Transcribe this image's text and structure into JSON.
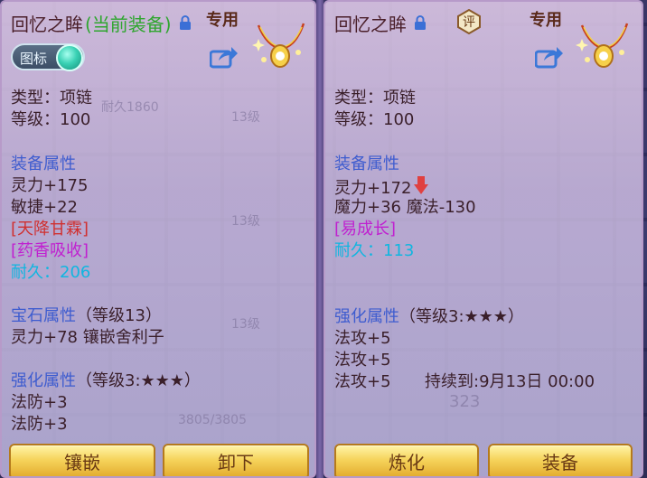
{
  "left_panel": {
    "title": "回忆之眸",
    "equipped_label": "(当前装备)",
    "special_label": "专用",
    "badge_label": "图标",
    "type_line": "类型：项链",
    "level_line": "等级：100",
    "equip_attr_head": "装备属性",
    "attrs": [
      {
        "text": "灵力+175",
        "style": "dark"
      },
      {
        "text": "敏捷+22",
        "style": "dark"
      },
      {
        "text": "[天降甘霖]",
        "style": "red"
      },
      {
        "text": "[药香吸收]",
        "style": "purple"
      },
      {
        "text": "耐久：206",
        "style": "cyan"
      }
    ],
    "gem_head": "宝石属性",
    "gem_level": "（等级13）",
    "gem_line": "灵力+78 镶嵌舍利子",
    "enhance_head": "强化属性",
    "enhance_level": "（等级3:★★★）",
    "enhance_lines": [
      "法防+3",
      "法防+3"
    ],
    "buttons": {
      "inlay": "镶嵌",
      "unload": "卸下"
    },
    "background_text": {
      "durability": "耐久1860",
      "lvl_a": "13级",
      "lvl_b": "13级",
      "lvl_c": "13级",
      "hp": "3805/3805"
    }
  },
  "right_panel": {
    "title": "回忆之眸",
    "eval_label": "评",
    "special_label": "专用",
    "type_line": "类型：项链",
    "level_line": "等级：100",
    "equip_attr_head": "装备属性",
    "attr1": "灵力+172",
    "attr2": "魔力+36 魔法-130",
    "attr3": "[易成长]",
    "attr4": "耐久：113",
    "enhance_head": "强化属性",
    "enhance_level": "（等级3:★★★）",
    "enhance_lines": [
      "法攻+5",
      "法攻+5"
    ],
    "enhance_last": "法攻+5",
    "duration": "持续到:9月13日 00:00",
    "buttons": {
      "refine": "炼化",
      "equip": "装备"
    },
    "background_text": {
      "num": "323"
    }
  },
  "colors": {
    "heading": "#3e5ccf",
    "red": "#d03030",
    "purple": "#c020d0",
    "cyan": "#10b6e0",
    "green": "#2fa62f"
  }
}
